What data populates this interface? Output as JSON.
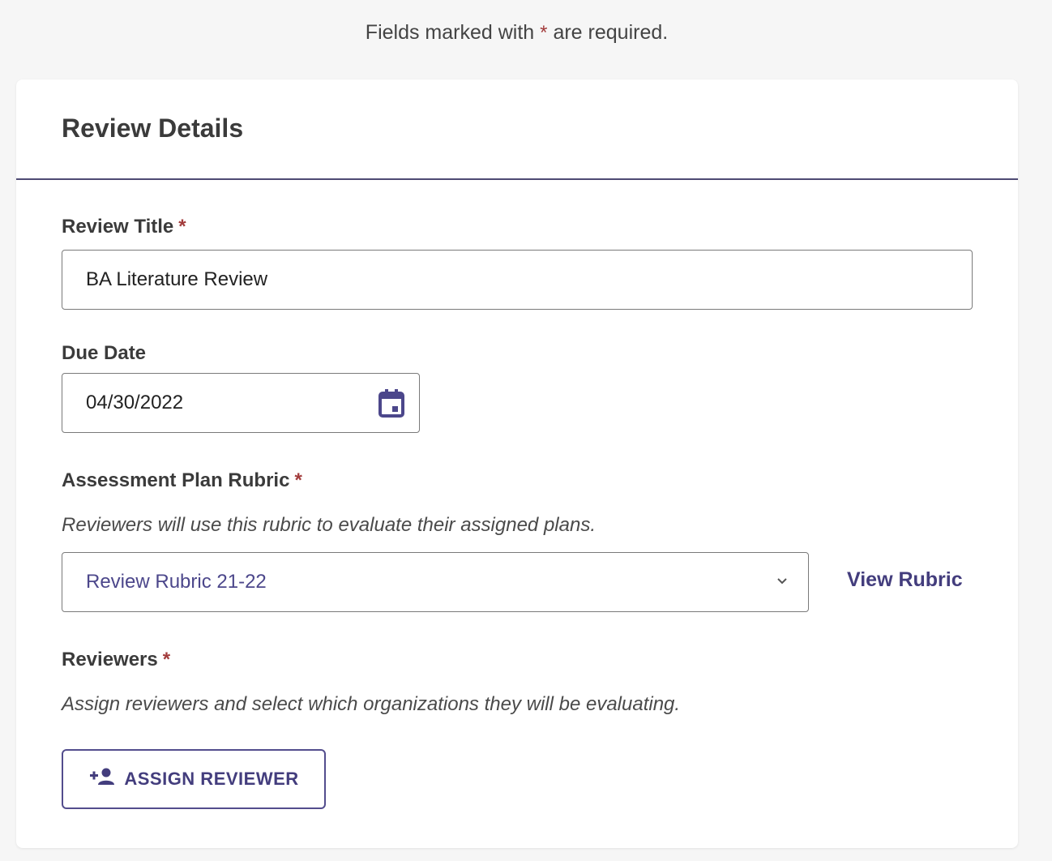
{
  "requirement_note": {
    "prefix": "Fields marked with",
    "asterisk": "*",
    "suffix": "are required."
  },
  "card": {
    "title": "Review Details"
  },
  "review_title": {
    "label": "Review Title",
    "required_mark": "*",
    "value": "BA Literature Review"
  },
  "due_date": {
    "label": "Due Date",
    "value": "04/30/2022",
    "icon": "calendar-icon"
  },
  "rubric": {
    "label": "Assessment Plan Rubric",
    "required_mark": "*",
    "help": "Reviewers will use this rubric to evaluate their assigned plans.",
    "selected": "Review Rubric 21-22",
    "view_link": "View Rubric",
    "icon": "chevron-down-icon"
  },
  "reviewers": {
    "label": "Reviewers",
    "required_mark": "*",
    "help": "Assign reviewers and select which organizations they will be evaluating.",
    "assign_button": "ASSIGN REVIEWER",
    "icon": "add-person-icon"
  },
  "colors": {
    "accent": "#433d7d",
    "required": "#a23b3b",
    "divider": "#4e4a73"
  }
}
